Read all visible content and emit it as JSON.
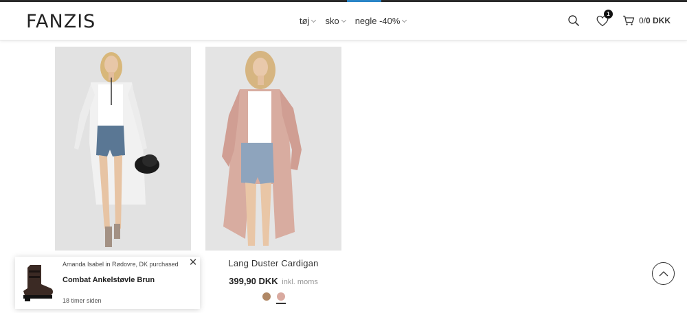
{
  "brand": {
    "logo_text": "FANZIS",
    "accent_color": "#2a86c8"
  },
  "nav": {
    "items": [
      {
        "label": "tøj"
      },
      {
        "label": "sko"
      },
      {
        "label": "negle -40%"
      }
    ]
  },
  "header": {
    "search_icon": "search-icon",
    "wishlist_icon": "heart-icon",
    "wishlist_count": "1",
    "cart_icon": "cart-icon",
    "cart_count": "0",
    "cart_separator": "/",
    "cart_total": "0 DKK"
  },
  "products": [
    {
      "title": "",
      "price": "",
      "tax_note": "",
      "swatches": []
    },
    {
      "title": "Lang Duster Cardigan",
      "price": "399,90 DKK",
      "tax_note": "inkl. moms",
      "swatches": [
        "#b08866",
        "#d9aaa0"
      ]
    }
  ],
  "popup": {
    "who": "Amanda Isabel in Rødovre, DK purchased",
    "product": "Combat Ankelstøvle Brun",
    "time": "18 timer siden",
    "close_icon": "close-icon"
  },
  "scroll_top_icon": "chevron-up-icon"
}
